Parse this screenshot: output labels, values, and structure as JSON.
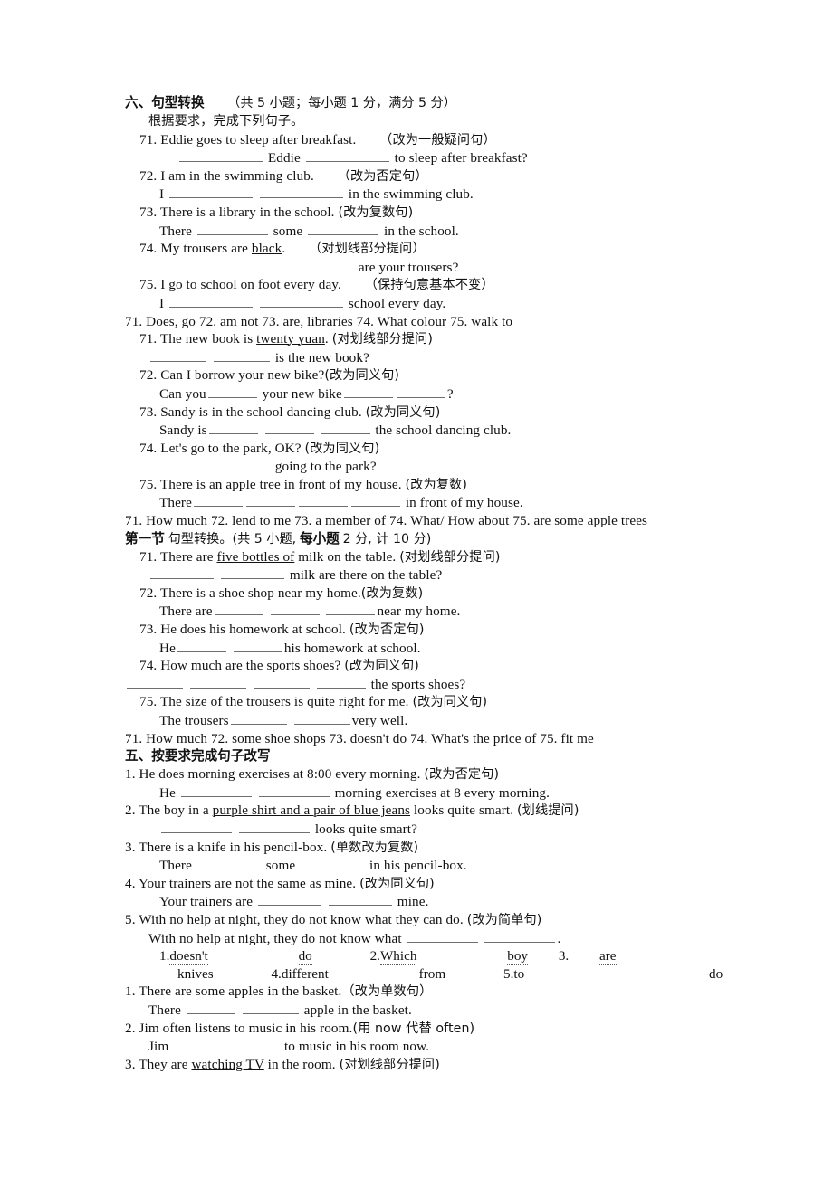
{
  "document": {
    "type": "chinese-english-worksheet",
    "page_background": "#ffffff",
    "text_color": "#111111"
  },
  "section_six": {
    "heading_label": "六、句型转换",
    "heading_paren": "（共 5 小题；每小题 1 分，满分 5 分）",
    "instruction": "根据要求，完成下列句子。",
    "items": [
      {
        "num": "71.",
        "prompt": "Eddie goes to sleep after breakfast.",
        "tag": "（改为一般疑问句）",
        "answer_line_pre": "",
        "answer_line_mid": "Eddie",
        "answer_line_post": "to sleep after breakfast?"
      },
      {
        "num": "72.",
        "prompt": "I am in the swimming club.",
        "tag": "（改为否定句）",
        "answer_line_pre": "I",
        "answer_line_post": "in the swimming club."
      },
      {
        "num": "73.",
        "prompt": "There is a library in the school.",
        "tag": "(改为复数句)",
        "answer_line_pre": "There",
        "answer_line_mid": "some",
        "answer_line_post": "in the school."
      },
      {
        "num": "74.",
        "prompt_a": "My trousers are ",
        "prompt_underlined": "black",
        "prompt_b": ".",
        "tag": "（对划线部分提问）",
        "answer_line_post": "are your trousers?"
      },
      {
        "num": "75.",
        "prompt": "I go to school on foot every day.",
        "tag": "（保持句意基本不变）",
        "answer_line_pre": "I",
        "answer_line_post": "school every day."
      }
    ],
    "answer_key": "71. Does, go    72. am not      73. are, libraries      74. What colour      75. walk to"
  },
  "block_two": {
    "items": [
      {
        "num": "71.",
        "prompt_a": "The new book is ",
        "prompt_underlined": "twenty yuan",
        "prompt_b": ".",
        "tag": "(对划线部分提问)",
        "answer_line_post": "is the new book?"
      },
      {
        "num": "72.",
        "prompt": "Can I borrow your new bike?",
        "tag": "(改为同义句)",
        "answer_line_pre": "Can you",
        "answer_line_mid": "your new bike",
        "answer_line_post": "?"
      },
      {
        "num": "73.",
        "prompt": "Sandy is in the school dancing club.",
        "tag": "(改为同义句)",
        "answer_line_pre": "Sandy is",
        "answer_line_post": "the school dancing club."
      },
      {
        "num": "74.",
        "prompt": "Let's go to the park, OK?",
        "tag": "(改为同义句)",
        "answer_line_post": "going to the park?"
      },
      {
        "num": "75.",
        "prompt": "There is an apple tree in front of my house.",
        "tag": "(改为复数)",
        "answer_line_pre": "There",
        "answer_line_post": "in front of my house."
      }
    ],
    "answer_key": "71. How much 72. lend to me 73. a member of 74. What/ How about 75. are some apple trees"
  },
  "section_first": {
    "heading_bold_a": "第一节",
    "heading_rest": "句型转换。(共 5 小题,",
    "heading_bold_b": "每小题",
    "heading_rest_b": "2 分, 计 10 分)",
    "items": [
      {
        "num": "71.",
        "prompt_a": "There are ",
        "prompt_underlined": "five bottles of",
        "prompt_b": " milk on the table.",
        "tag": "(对划线部分提问)",
        "answer_line_post": "milk are there on the table?"
      },
      {
        "num": "72.",
        "prompt": "There is a shoe shop near my home.",
        "tag": "(改为复数)",
        "answer_line_pre": "There are",
        "answer_line_post": "near my home."
      },
      {
        "num": "73.",
        "prompt": "He does his homework at school.",
        "tag": "(改为否定句)",
        "answer_line_pre": "He",
        "answer_line_post": "his homework at school."
      },
      {
        "num": "74.",
        "prompt": "How much are the sports shoes?",
        "tag": "(改为同义句)",
        "answer_line_post": "the sports shoes?"
      },
      {
        "num": "75.",
        "prompt": "The size of the trousers is quite right for me.",
        "tag": "(改为同义句)",
        "answer_line_pre": "The trousers",
        "answer_line_post": "very well."
      }
    ],
    "answer_key": "71. How much 72. some shoe shops 73. doesn't do 74. What's the price of 75. fit me"
  },
  "section_five": {
    "heading": "五、按要求完成句子改写",
    "items": [
      {
        "num": "1.",
        "prompt": "He does morning exercises at 8:00 every morning.",
        "tag": "(改为否定句)",
        "answer_line_pre": "He",
        "answer_line_post": "morning exercises at 8 every morning."
      },
      {
        "num": "2.",
        "prompt_a": "The boy in a ",
        "prompt_underlined": "purple shirt and a pair of blue jeans",
        "prompt_b": " looks quite smart.",
        "tag": "(划线提问)",
        "answer_line_post": "looks quite smart?"
      },
      {
        "num": "3.",
        "prompt": "There is a knife in his pencil-box.",
        "tag": "(单数改为复数)",
        "answer_line_pre": "There",
        "answer_line_mid": "some",
        "answer_line_post": "in his pencil-box."
      },
      {
        "num": "4.",
        "prompt": "Your trainers are not the same as mine.",
        "tag": "(改为同义句)",
        "answer_line_pre": "Your trainers are",
        "answer_line_post": "mine."
      },
      {
        "num": "5.",
        "prompt": "With no help at night, they do not know what they can do.",
        "tag": "(改为简单句)",
        "answer_line_pre": "With no help at night, they do not know what",
        "answer_line_post": "."
      }
    ],
    "answer_key_row1": [
      {
        "label": "1.",
        "word": "doesn't"
      },
      {
        "label": "",
        "word": "do"
      },
      {
        "label": "2.",
        "word": "Which"
      },
      {
        "label": "",
        "word": "boy"
      },
      {
        "label": "3.",
        "word": "are"
      }
    ],
    "answer_key_row2": [
      {
        "label": "",
        "word": "knives"
      },
      {
        "label": "4.",
        "word": "different"
      },
      {
        "label": "",
        "word": "from"
      },
      {
        "label": "5.",
        "word": "to"
      },
      {
        "label": "",
        "word": "do"
      }
    ]
  },
  "section_last": {
    "items": [
      {
        "num": "1.",
        "prompt": "There are some apples in the basket.",
        "tag": "（改为单数句）",
        "answer_line_pre": "There",
        "answer_line_post": "apple in the basket."
      },
      {
        "num": "2.",
        "prompt": "Jim often listens to music in his room.",
        "tag": "(用 now  代替 often)",
        "answer_line_pre": "Jim",
        "answer_line_post": "to music in his room now."
      },
      {
        "num": "3.",
        "prompt_a": "They are ",
        "prompt_underlined": "watching TV",
        "prompt_b": " in the room.",
        "tag": "(对划线部分提问)"
      }
    ]
  }
}
